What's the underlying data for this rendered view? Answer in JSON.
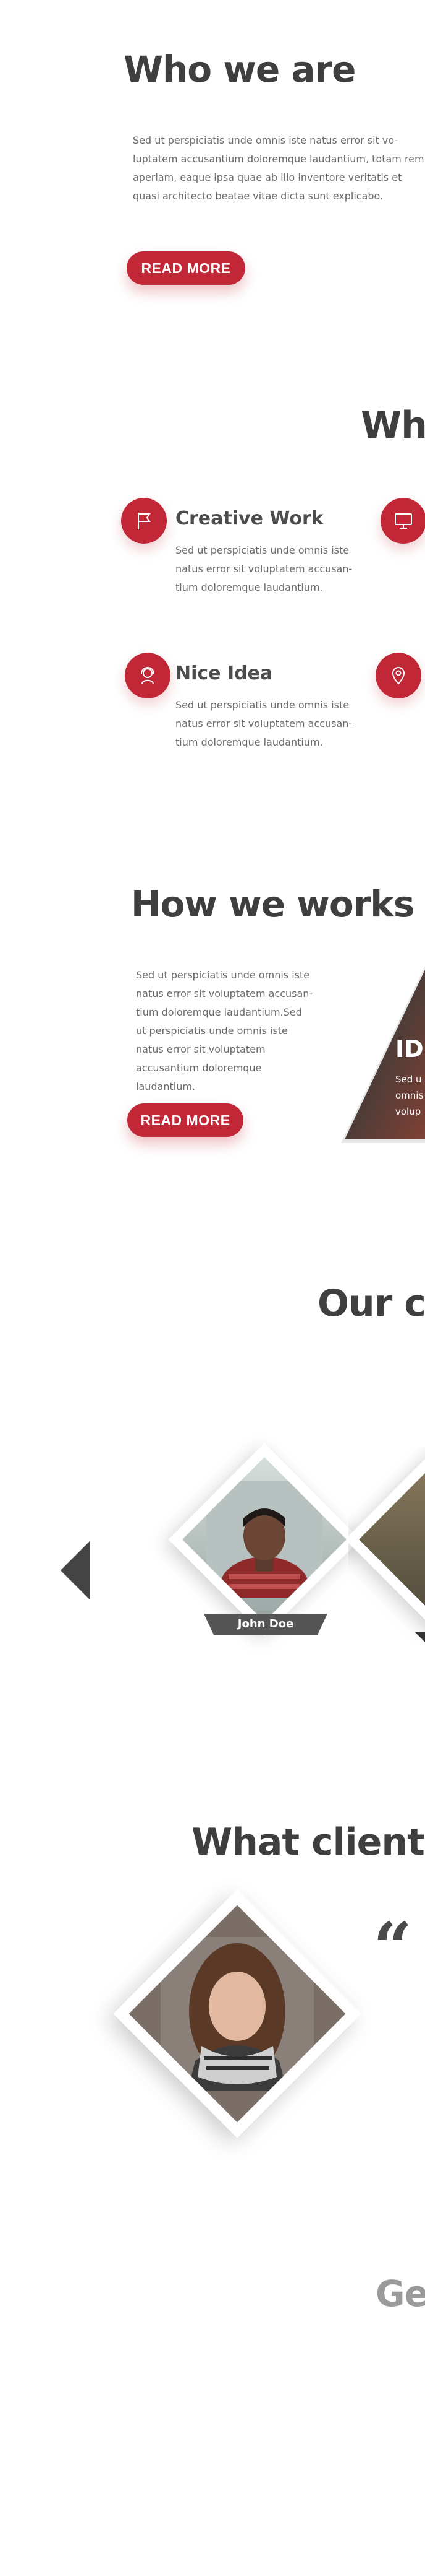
{
  "about": {
    "heading": "Who we are",
    "paragraph": "Sed ut perspiciatis unde omnis iste natus error sit vo-luptatem accusantium doloremque laudantium, totam rem aperiam, eaque ipsa quae ab illo inventore veritatis et quasi architecto beatae vitae dicta sunt explicabo.",
    "button": "READ MORE"
  },
  "services": {
    "heading_partial": "Wh",
    "items": [
      {
        "title": "Creative Work",
        "text": "Sed ut perspiciatis unde omnis iste natus error sit voluptatem accusan-tium doloremque laudantium.",
        "icon": "flag-icon"
      },
      {
        "title": "",
        "text": "",
        "icon": "monitor-icon"
      },
      {
        "title": "Nice Idea",
        "text": "Sed ut perspiciatis unde omnis iste natus error sit voluptatem accusan-tium doloremque laudantium.",
        "icon": "headset-icon"
      },
      {
        "title": "",
        "text": "",
        "icon": "map-pin-icon"
      }
    ]
  },
  "how": {
    "heading": "How we works",
    "paragraph": "Sed ut perspiciatis unde omnis iste natus error sit voluptatem accusan-tium doloremque laudantium.Sed ut perspiciatis unde omnis iste natus error sit voluptatem accusantium doloremque laudantium.",
    "button": "READ MORE",
    "card_title": "ID",
    "card_text": "Sed u omnis volup"
  },
  "team": {
    "heading_partial": "Our cr",
    "members": [
      {
        "name": "John Doe"
      }
    ]
  },
  "testimonials": {
    "heading_partial": "What client",
    "quote_mark": "“"
  },
  "footer_partial": {
    "heading_partial": "Ge"
  },
  "colors": {
    "accent": "#c12737",
    "heading": "#3f3f3f",
    "text": "#6a6a6a"
  }
}
